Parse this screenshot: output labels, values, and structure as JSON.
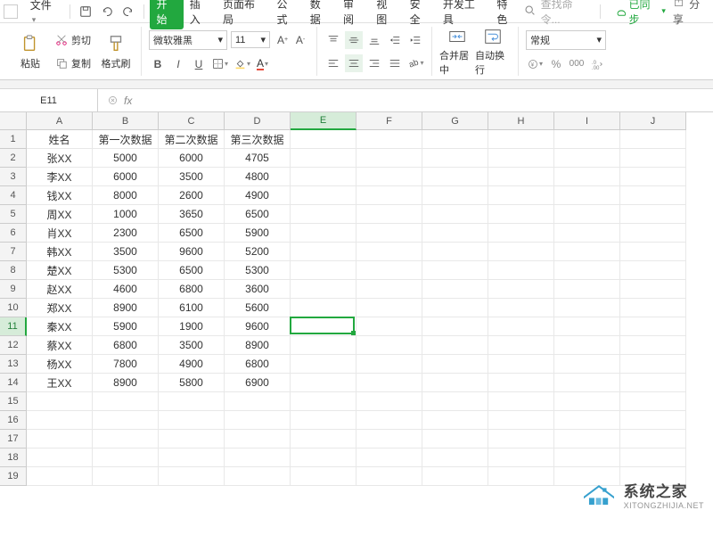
{
  "menubar": {
    "file": "文件",
    "tabs": [
      "开始",
      "插入",
      "页面布局",
      "公式",
      "数据",
      "审阅",
      "视图",
      "安全",
      "开发工具",
      "特色"
    ],
    "active_tab_index": 0,
    "search_placeholder": "查找命令...",
    "sync": "已同步",
    "share": "分享"
  },
  "ribbon": {
    "paste": "粘贴",
    "cut": "剪切",
    "copy": "复制",
    "format_painter": "格式刷",
    "font_name": "微软雅黑",
    "font_size": "11",
    "merge_center": "合并居中",
    "wrap_text": "自动换行",
    "number_format": "常规"
  },
  "namebox": "E11",
  "active_cell": {
    "col": 4,
    "row": 10
  },
  "columns": [
    "A",
    "B",
    "C",
    "D",
    "E",
    "F",
    "G",
    "H",
    "I",
    "J"
  ],
  "row_count": 19,
  "headers": [
    "姓名",
    "第一次数据",
    "第二次数据",
    "第三次数据"
  ],
  "rows": [
    {
      "name": "张XX",
      "v1": "5000",
      "v2": "6000",
      "v3": "4705"
    },
    {
      "name": "李XX",
      "v1": "6000",
      "v2": "3500",
      "v3": "4800"
    },
    {
      "name": "钱XX",
      "v1": "8000",
      "v2": "2600",
      "v3": "4900"
    },
    {
      "name": "周XX",
      "v1": "1000",
      "v2": "3650",
      "v3": "6500"
    },
    {
      "name": "肖XX",
      "v1": "2300",
      "v2": "6500",
      "v3": "5900"
    },
    {
      "name": "韩XX",
      "v1": "3500",
      "v2": "9600",
      "v3": "5200"
    },
    {
      "name": "楚XX",
      "v1": "5300",
      "v2": "6500",
      "v3": "5300"
    },
    {
      "name": "赵XX",
      "v1": "4600",
      "v2": "6800",
      "v3": "3600"
    },
    {
      "name": "郑XX",
      "v1": "8900",
      "v2": "6100",
      "v3": "5600"
    },
    {
      "name": "秦XX",
      "v1": "5900",
      "v2": "1900",
      "v3": "9600"
    },
    {
      "name": "蔡XX",
      "v1": "6800",
      "v2": "3500",
      "v3": "8900"
    },
    {
      "name": "杨XX",
      "v1": "7800",
      "v2": "4900",
      "v3": "6800"
    },
    {
      "name": "王XX",
      "v1": "8900",
      "v2": "5800",
      "v3": "6900"
    }
  ],
  "watermark": {
    "cn": "系统之家",
    "en": "XITONGZHIJIA.NET"
  }
}
